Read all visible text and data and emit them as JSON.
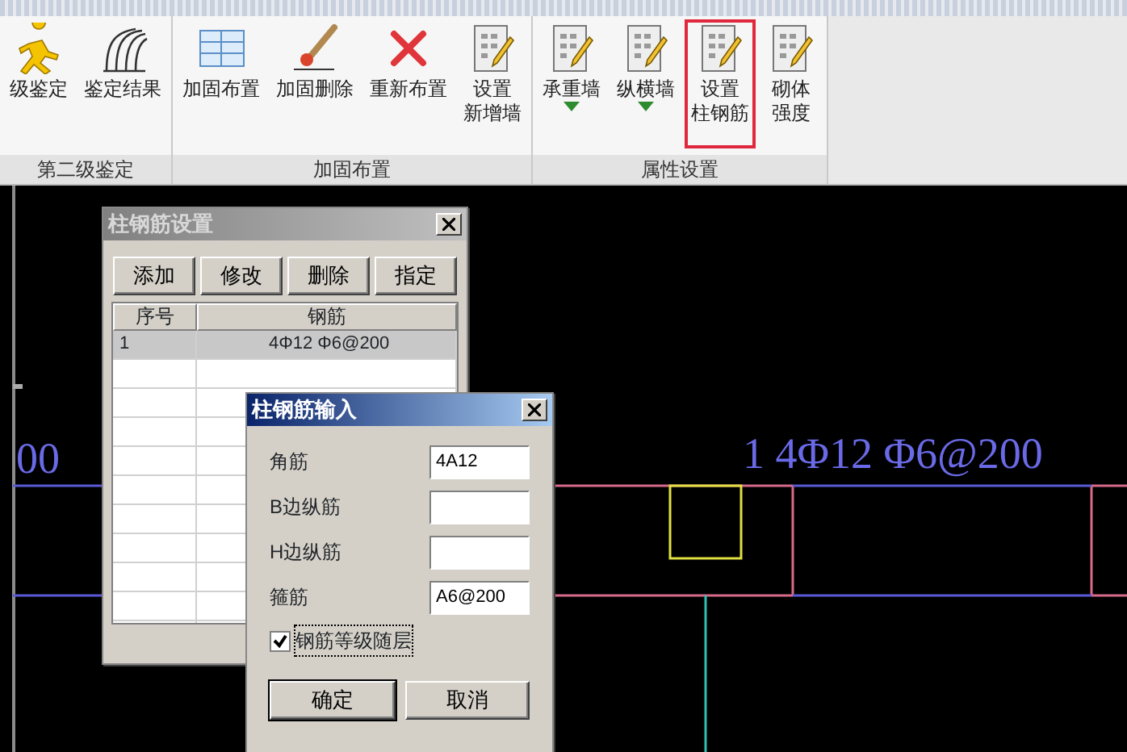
{
  "ribbon": {
    "groups": [
      {
        "label": "第二级鉴定",
        "buttons": [
          {
            "kind": "runner",
            "lines": [
              "级鉴定"
            ],
            "dropdown": false,
            "selected": false
          },
          {
            "kind": "curves",
            "lines": [
              "鉴定结果"
            ],
            "dropdown": false,
            "selected": false
          }
        ]
      },
      {
        "label": "加固布置",
        "buttons": [
          {
            "kind": "grid",
            "lines": [
              "加固布置"
            ],
            "dropdown": false,
            "selected": false
          },
          {
            "kind": "brush",
            "lines": [
              "加固删除"
            ],
            "dropdown": false,
            "selected": false
          },
          {
            "kind": "cross",
            "lines": [
              "重新布置"
            ],
            "dropdown": false,
            "selected": false
          },
          {
            "kind": "sheet",
            "lines": [
              "设置",
              "新增墙"
            ],
            "dropdown": false,
            "selected": false
          }
        ]
      },
      {
        "label": "属性设置",
        "buttons": [
          {
            "kind": "sheet",
            "lines": [
              "承重墙"
            ],
            "dropdown": true,
            "selected": false
          },
          {
            "kind": "sheet",
            "lines": [
              "纵横墙"
            ],
            "dropdown": true,
            "selected": false
          },
          {
            "kind": "sheet",
            "lines": [
              "设置",
              "柱钢筋"
            ],
            "dropdown": false,
            "selected": true
          },
          {
            "kind": "sheet",
            "lines": [
              "砌体",
              "强度"
            ],
            "dropdown": false,
            "selected": false
          }
        ]
      }
    ]
  },
  "canvas": {
    "labels": [
      {
        "text": "00"
      },
      {
        "text": "1 4Φ12 Φ6@200"
      }
    ]
  },
  "list_dialog": {
    "title": "柱钢筋设置",
    "active": false,
    "buttons": [
      "添加",
      "修改",
      "删除",
      "指定"
    ],
    "columns": [
      "序号",
      "钢筋"
    ],
    "rows": [
      {
        "cells": [
          "1",
          "4Φ12 Φ6@200"
        ],
        "selected": true
      }
    ]
  },
  "input_dialog": {
    "title": "柱钢筋输入",
    "active": true,
    "fields": [
      {
        "label": "角筋",
        "value": "4A12"
      },
      {
        "label": "B边纵筋"
      },
      {
        "label": "H边纵筋"
      },
      {
        "label": "箍筋",
        "value": "A6@200"
      }
    ],
    "checkbox": {
      "label": "钢筋等级随层",
      "checked": true
    },
    "buttons": [
      "确定",
      "取消"
    ]
  }
}
